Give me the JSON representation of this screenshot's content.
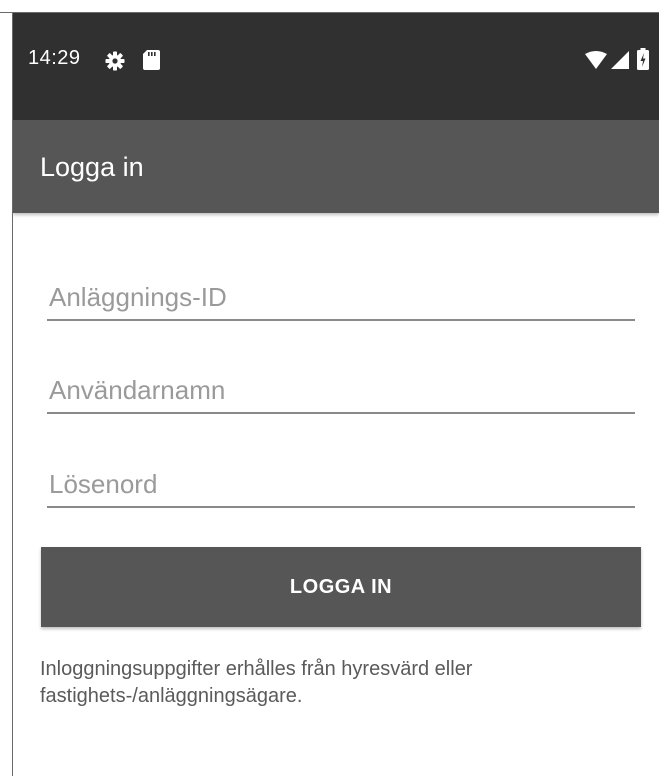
{
  "status_bar": {
    "time": "14:29",
    "icons": [
      "gear-icon",
      "sd-card-icon",
      "wifi-icon",
      "cell-signal-icon",
      "battery-icon"
    ]
  },
  "app_bar": {
    "title": "Logga in"
  },
  "form": {
    "facility_id_placeholder": "Anläggnings-ID",
    "username_placeholder": "Användarnamn",
    "password_placeholder": "Lösenord",
    "facility_id_value": "",
    "username_value": "",
    "password_value": "",
    "login_button_label": "LOGGA IN"
  },
  "info": {
    "text": "Inloggningsuppgifter erhålles från hyresvärd eller fastighets-/anläggningsägare."
  },
  "colors": {
    "status_bar": "#303030",
    "app_bar": "#565656",
    "button": "#565656",
    "underline": "#8a8a8a",
    "placeholder": "#9a9a9a",
    "info_text": "#5a5a5a"
  }
}
